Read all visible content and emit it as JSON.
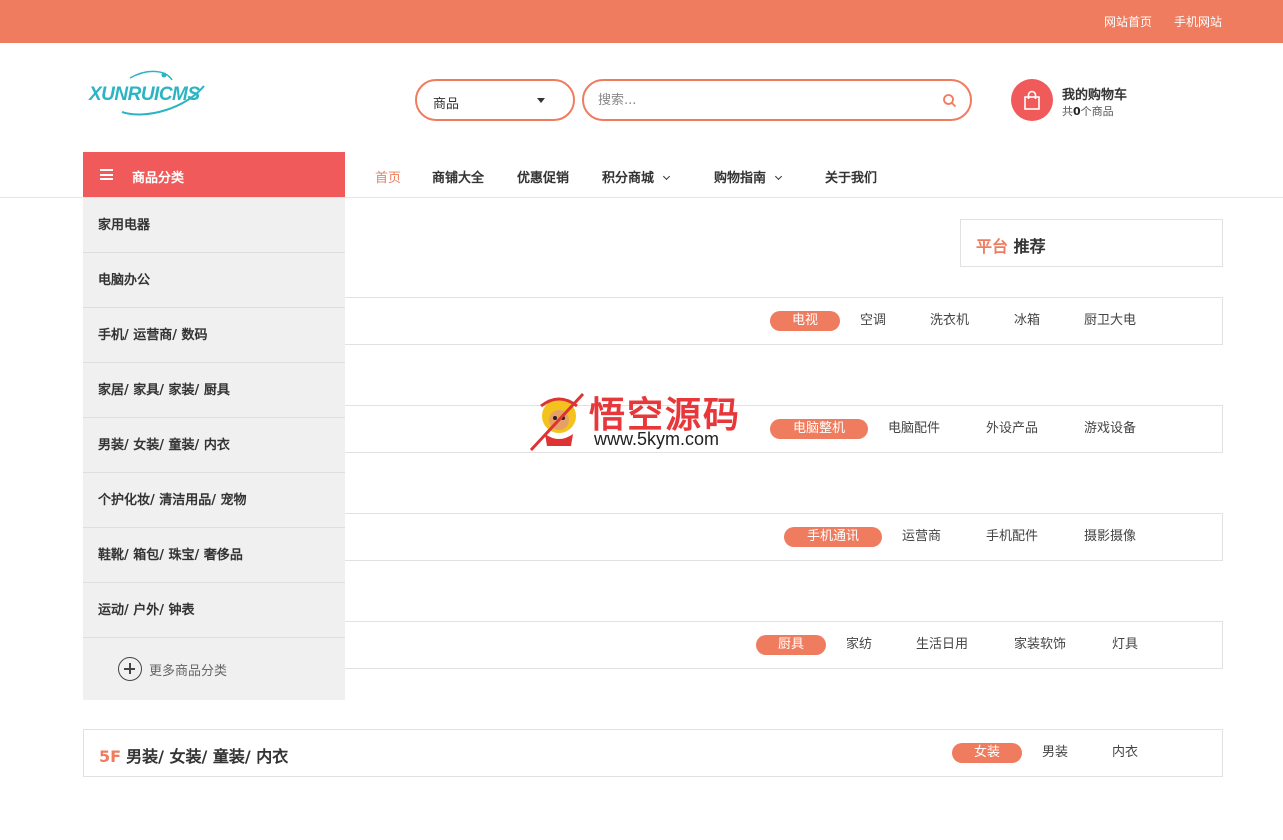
{
  "topbar": {
    "home_link": "网站首页",
    "mobile_link": "手机网站"
  },
  "logo": {
    "text": "XUNRUICMS"
  },
  "search": {
    "category_selected": "商品",
    "placeholder": "搜索..."
  },
  "cart": {
    "title": "我的购物车",
    "count_prefix": "共",
    "count": "0",
    "count_suffix": "个商品"
  },
  "category_menu": {
    "label": "商品分类",
    "items": [
      "家用电器",
      "电脑办公",
      "手机/ 运营商/ 数码",
      "家居/ 家具/ 家装/ 厨具",
      "男装/ 女装/ 童装/ 内衣",
      "个护化妆/ 清洁用品/ 宠物",
      "鞋靴/ 箱包/ 珠宝/ 奢侈品",
      "运动/ 户外/ 钟表"
    ],
    "more": "更多商品分类"
  },
  "nav": {
    "items": [
      "首页",
      "商铺大全",
      "优惠促销",
      "积分商城",
      "购物指南",
      "关于我们"
    ]
  },
  "recommend": {
    "highlight": "平台",
    "rest": " 推荐"
  },
  "floors": [
    {
      "tabs": [
        "电视",
        "空调",
        "洗衣机",
        "冰箱",
        "厨卫大电"
      ]
    },
    {
      "tabs": [
        "电脑整机",
        "电脑配件",
        "外设产品",
        "游戏设备"
      ]
    },
    {
      "tabs": [
        "手机通讯",
        "运营商",
        "手机配件",
        "摄影摄像"
      ]
    },
    {
      "tabs": [
        "厨具",
        "家纺",
        "生活日用",
        "家装软饰",
        "灯具"
      ]
    },
    {
      "number": "5F",
      "title": "男装/ 女装/ 童装/ 内衣",
      "tabs": [
        "女装",
        "男装",
        "内衣"
      ]
    }
  ],
  "watermark": {
    "brand": "悟空源码",
    "url": "www.5kym.com"
  },
  "colors": {
    "accent": "#ef7c5e",
    "category_red": "#f05a5a",
    "menu_bg": "#f0f0f0"
  }
}
